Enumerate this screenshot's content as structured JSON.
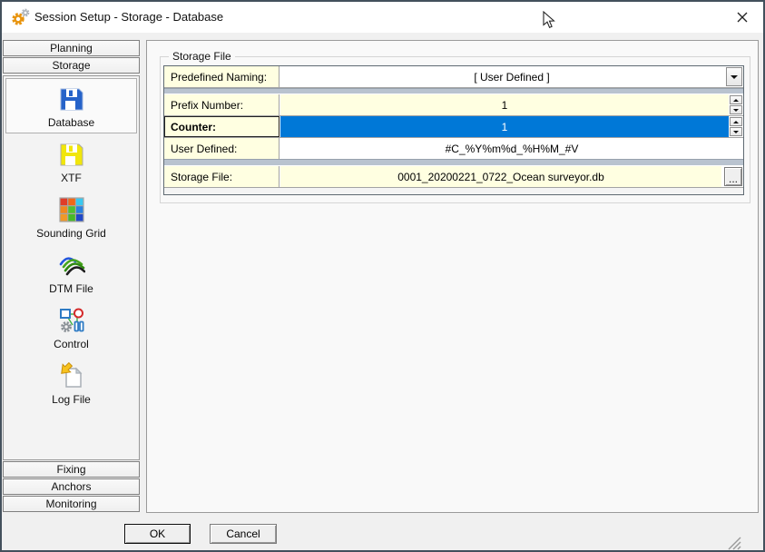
{
  "window": {
    "title": "Session Setup - Storage - Database"
  },
  "sidebar": {
    "top_buttons": [
      {
        "label": "Planning"
      },
      {
        "label": "Storage"
      }
    ],
    "items": [
      {
        "label": "Database",
        "icon": "floppy-blue-icon",
        "selected": true
      },
      {
        "label": "XTF",
        "icon": "floppy-yellow-icon",
        "selected": false
      },
      {
        "label": "Sounding Grid",
        "icon": "color-grid-icon",
        "selected": false
      },
      {
        "label": "DTM File",
        "icon": "dtm-swoosh-icon",
        "selected": false
      },
      {
        "label": "Control",
        "icon": "control-shapes-icon",
        "selected": false
      },
      {
        "label": "Log File",
        "icon": "log-file-icon",
        "selected": false
      }
    ],
    "bottom_buttons": [
      {
        "label": "Fixing"
      },
      {
        "label": "Anchors"
      },
      {
        "label": "Monitoring"
      }
    ]
  },
  "form": {
    "group_title": "Storage File",
    "rows": [
      {
        "label": "Predefined Naming:",
        "value": "[ User Defined ]",
        "type": "dropdown"
      },
      {
        "label": "Prefix Number:",
        "value": "1",
        "type": "spinner"
      },
      {
        "label": "Counter:",
        "value": "1",
        "type": "spinner",
        "selected": true
      },
      {
        "label": "User Defined:",
        "value": "#C_%Y%m%d_%H%M_#V",
        "type": "text"
      },
      {
        "label": "Storage File:",
        "value": "0001_20200221_0722_Ocean surveyor.db",
        "type": "browse",
        "browse_label": "..."
      }
    ]
  },
  "footer": {
    "ok_label": "OK",
    "cancel_label": "Cancel"
  },
  "colors": {
    "selection_blue": "#0078D7",
    "label_yellow": "#FFFFE1",
    "separator_blue_gray": "#B9C3CF",
    "window_border": "#43505C",
    "titlebar_bg": "#FFFFFF",
    "app_gear_orange": "#E8940E"
  }
}
